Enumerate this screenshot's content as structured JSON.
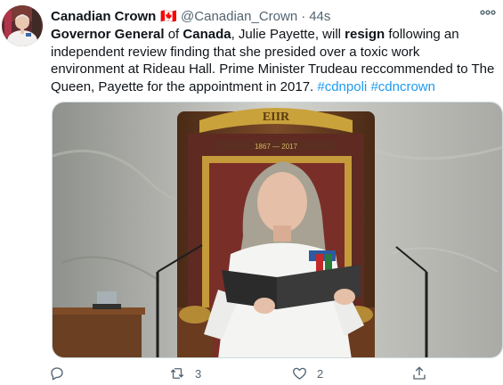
{
  "author": {
    "name": "Canadian Crown",
    "flag": "🇨🇦",
    "handle": "@Canadian_Crown",
    "separator": "·",
    "time": "44s"
  },
  "tweet": {
    "t1": "Governor General",
    "t2": " of ",
    "t3": "Canada",
    "t4": ", Julie Payette, will ",
    "t5": "resign",
    "t6": " following an independent review finding that she presided over a toxic work environment at Rideau Hall. Prime Minister Trudeau reccommended to The Queen, Payette for the appointment in 2017. ",
    "hashtag1": "#cdnpoli",
    "space": " ",
    "hashtag2": "#cdncrown"
  },
  "media": {
    "crest_text": "EIIR",
    "throne_text": "1867 — 2017"
  },
  "actions": {
    "reply_icon": "reply-icon",
    "retweet_count": "3",
    "like_count": "2",
    "share_icon": "share-icon"
  },
  "colors": {
    "accent": "#1d9bf0",
    "muted": "#536471",
    "text": "#0f1419"
  }
}
